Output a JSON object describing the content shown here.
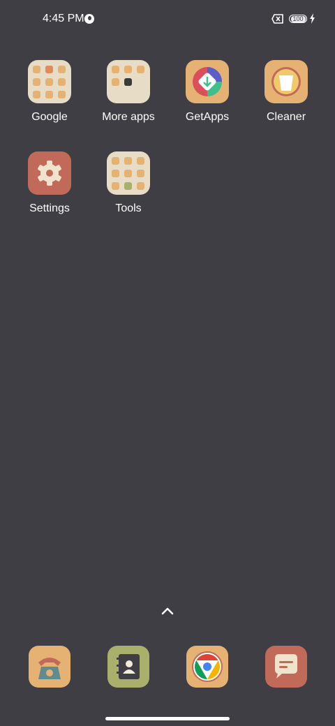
{
  "status_bar": {
    "time": "4:45 PM",
    "battery_level": "100",
    "icons": [
      "do-not-disturb-icon",
      "no-sim-icon",
      "battery-icon",
      "charging-bolt-icon"
    ]
  },
  "home": {
    "apps": [
      {
        "label": "Google",
        "type": "folder"
      },
      {
        "label": "More apps",
        "type": "folder"
      },
      {
        "label": "GetApps",
        "type": "app"
      },
      {
        "label": "Cleaner",
        "type": "app"
      },
      {
        "label": "Settings",
        "type": "app"
      },
      {
        "label": "Tools",
        "type": "folder"
      }
    ]
  },
  "dock": {
    "apps": [
      "phone-icon",
      "contacts-icon",
      "chrome-icon",
      "messages-icon"
    ]
  },
  "colors": {
    "background": "#3f3e44",
    "tile_tan": "#e6b274",
    "tile_terracotta": "#c26a5a",
    "tile_olive": "#a8b06c",
    "folder_cream": "#e7ddc7"
  }
}
